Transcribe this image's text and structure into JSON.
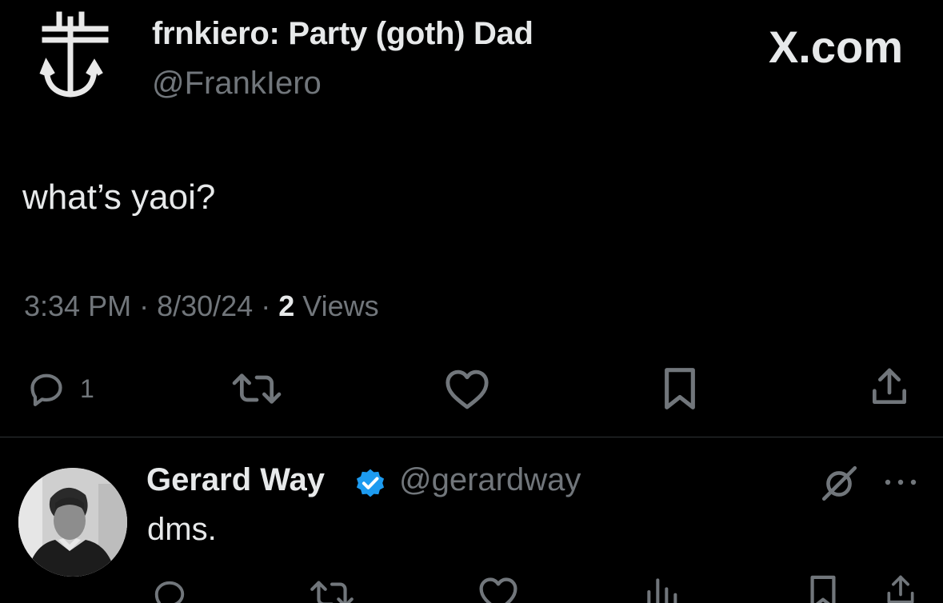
{
  "tweet": {
    "author": {
      "display_name": "frnkiero: Party (goth) Dad",
      "handle": "@FrankIero",
      "avatar_icon": "anchor-cross-logo"
    },
    "brand": "X.com",
    "text": "what’s yaoi?",
    "meta": {
      "time": "3:34 PM",
      "separator": "·",
      "date": "8/30/24",
      "views_count": "2",
      "views_label": "Views"
    },
    "actions": {
      "reply_count": "1",
      "reply_icon": "reply-icon",
      "retweet_icon": "retweet-icon",
      "like_icon": "heart-icon",
      "bookmark_icon": "bookmark-icon",
      "share_icon": "share-icon"
    }
  },
  "reply": {
    "author": {
      "display_name": "Gerard Way",
      "handle": "@gerardway",
      "verified": true,
      "verified_color": "#1d9bf0"
    },
    "text": "dms."
  },
  "colors": {
    "background": "#000000",
    "primary_text": "#e7e9ea",
    "secondary_text": "#71767b",
    "divider": "#2f3336"
  }
}
